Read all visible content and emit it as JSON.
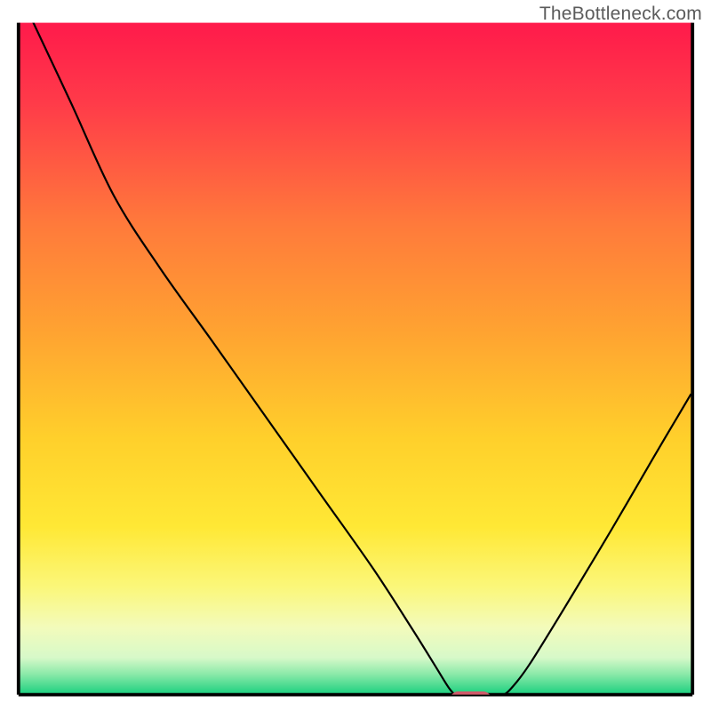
{
  "watermark": "TheBottleneck.com",
  "chart_data": {
    "type": "line",
    "title": "",
    "xlabel": "",
    "ylabel": "",
    "xlim": [
      0,
      100
    ],
    "ylim": [
      0,
      100
    ],
    "grid": false,
    "legend": false,
    "gradient_stops": [
      {
        "offset": 0.0,
        "color": "#ff1a4b"
      },
      {
        "offset": 0.12,
        "color": "#ff3b49"
      },
      {
        "offset": 0.3,
        "color": "#ff7a3b"
      },
      {
        "offset": 0.46,
        "color": "#ffa331"
      },
      {
        "offset": 0.62,
        "color": "#ffd02b"
      },
      {
        "offset": 0.75,
        "color": "#ffe835"
      },
      {
        "offset": 0.84,
        "color": "#fbf77a"
      },
      {
        "offset": 0.9,
        "color": "#f3fbbb"
      },
      {
        "offset": 0.945,
        "color": "#d7f9c9"
      },
      {
        "offset": 0.97,
        "color": "#89e9a8"
      },
      {
        "offset": 1.0,
        "color": "#19cf7e"
      }
    ],
    "series": [
      {
        "name": "bottleneck-curve",
        "color": "#000000",
        "stroke_width": 2.2,
        "points": [
          {
            "x": 4.6,
            "y": 97.0
          },
          {
            "x": 10.0,
            "y": 85.5
          },
          {
            "x": 16.0,
            "y": 72.5
          },
          {
            "x": 22.5,
            "y": 62.3
          },
          {
            "x": 30.0,
            "y": 51.8
          },
          {
            "x": 37.5,
            "y": 41.2
          },
          {
            "x": 45.0,
            "y": 30.6
          },
          {
            "x": 52.5,
            "y": 20.0
          },
          {
            "x": 58.0,
            "y": 11.5
          },
          {
            "x": 61.3,
            "y": 6.2
          },
          {
            "x": 63.1,
            "y": 3.3
          },
          {
            "x": 64.2,
            "y": 2.1
          },
          {
            "x": 65.5,
            "y": 1.6
          },
          {
            "x": 69.2,
            "y": 1.6
          },
          {
            "x": 70.6,
            "y": 2.1
          },
          {
            "x": 72.0,
            "y": 3.3
          },
          {
            "x": 74.5,
            "y": 6.6
          },
          {
            "x": 80.0,
            "y": 15.5
          },
          {
            "x": 86.0,
            "y": 25.5
          },
          {
            "x": 92.0,
            "y": 35.8
          },
          {
            "x": 97.2,
            "y": 44.6
          }
        ]
      }
    ],
    "marker": {
      "name": "optimum-marker",
      "shape": "rounded-rect",
      "x": 66.2,
      "y": 1.6,
      "w": 5.8,
      "h": 2.3,
      "rx": 1.15,
      "fill": "#d05a6a"
    },
    "axes_box": {
      "x0": 2.6,
      "y0": 2.3,
      "x1": 97.4,
      "y1": 96.8
    }
  }
}
